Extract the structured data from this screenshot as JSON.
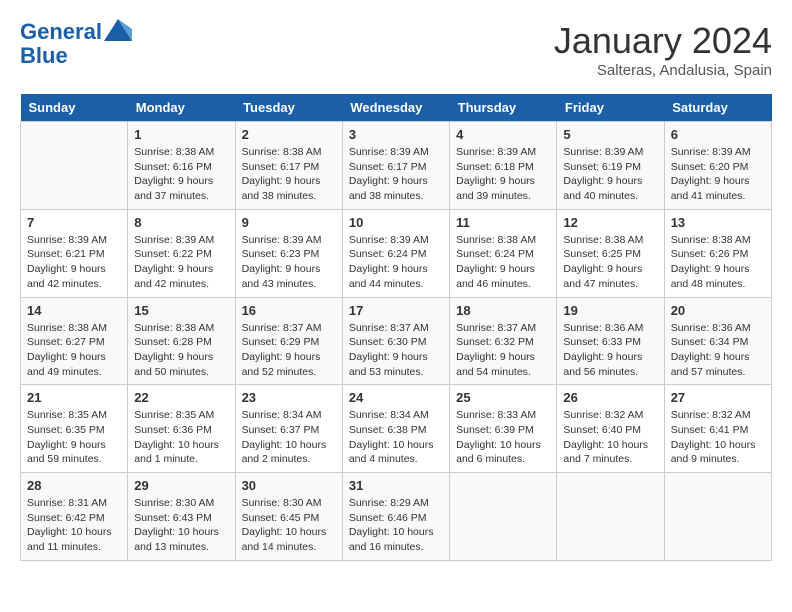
{
  "logo": {
    "line1": "General",
    "line2": "Blue"
  },
  "header": {
    "month": "January 2024",
    "location": "Salteras, Andalusia, Spain"
  },
  "weekdays": [
    "Sunday",
    "Monday",
    "Tuesday",
    "Wednesday",
    "Thursday",
    "Friday",
    "Saturday"
  ],
  "weeks": [
    [
      {
        "day": "",
        "info": ""
      },
      {
        "day": "1",
        "info": "Sunrise: 8:38 AM\nSunset: 6:16 PM\nDaylight: 9 hours\nand 37 minutes."
      },
      {
        "day": "2",
        "info": "Sunrise: 8:38 AM\nSunset: 6:17 PM\nDaylight: 9 hours\nand 38 minutes."
      },
      {
        "day": "3",
        "info": "Sunrise: 8:39 AM\nSunset: 6:17 PM\nDaylight: 9 hours\nand 38 minutes."
      },
      {
        "day": "4",
        "info": "Sunrise: 8:39 AM\nSunset: 6:18 PM\nDaylight: 9 hours\nand 39 minutes."
      },
      {
        "day": "5",
        "info": "Sunrise: 8:39 AM\nSunset: 6:19 PM\nDaylight: 9 hours\nand 40 minutes."
      },
      {
        "day": "6",
        "info": "Sunrise: 8:39 AM\nSunset: 6:20 PM\nDaylight: 9 hours\nand 41 minutes."
      }
    ],
    [
      {
        "day": "7",
        "info": "Sunrise: 8:39 AM\nSunset: 6:21 PM\nDaylight: 9 hours\nand 42 minutes."
      },
      {
        "day": "8",
        "info": "Sunrise: 8:39 AM\nSunset: 6:22 PM\nDaylight: 9 hours\nand 42 minutes."
      },
      {
        "day": "9",
        "info": "Sunrise: 8:39 AM\nSunset: 6:23 PM\nDaylight: 9 hours\nand 43 minutes."
      },
      {
        "day": "10",
        "info": "Sunrise: 8:39 AM\nSunset: 6:24 PM\nDaylight: 9 hours\nand 44 minutes."
      },
      {
        "day": "11",
        "info": "Sunrise: 8:38 AM\nSunset: 6:24 PM\nDaylight: 9 hours\nand 46 minutes."
      },
      {
        "day": "12",
        "info": "Sunrise: 8:38 AM\nSunset: 6:25 PM\nDaylight: 9 hours\nand 47 minutes."
      },
      {
        "day": "13",
        "info": "Sunrise: 8:38 AM\nSunset: 6:26 PM\nDaylight: 9 hours\nand 48 minutes."
      }
    ],
    [
      {
        "day": "14",
        "info": "Sunrise: 8:38 AM\nSunset: 6:27 PM\nDaylight: 9 hours\nand 49 minutes."
      },
      {
        "day": "15",
        "info": "Sunrise: 8:38 AM\nSunset: 6:28 PM\nDaylight: 9 hours\nand 50 minutes."
      },
      {
        "day": "16",
        "info": "Sunrise: 8:37 AM\nSunset: 6:29 PM\nDaylight: 9 hours\nand 52 minutes."
      },
      {
        "day": "17",
        "info": "Sunrise: 8:37 AM\nSunset: 6:30 PM\nDaylight: 9 hours\nand 53 minutes."
      },
      {
        "day": "18",
        "info": "Sunrise: 8:37 AM\nSunset: 6:32 PM\nDaylight: 9 hours\nand 54 minutes."
      },
      {
        "day": "19",
        "info": "Sunrise: 8:36 AM\nSunset: 6:33 PM\nDaylight: 9 hours\nand 56 minutes."
      },
      {
        "day": "20",
        "info": "Sunrise: 8:36 AM\nSunset: 6:34 PM\nDaylight: 9 hours\nand 57 minutes."
      }
    ],
    [
      {
        "day": "21",
        "info": "Sunrise: 8:35 AM\nSunset: 6:35 PM\nDaylight: 9 hours\nand 59 minutes."
      },
      {
        "day": "22",
        "info": "Sunrise: 8:35 AM\nSunset: 6:36 PM\nDaylight: 10 hours\nand 1 minute."
      },
      {
        "day": "23",
        "info": "Sunrise: 8:34 AM\nSunset: 6:37 PM\nDaylight: 10 hours\nand 2 minutes."
      },
      {
        "day": "24",
        "info": "Sunrise: 8:34 AM\nSunset: 6:38 PM\nDaylight: 10 hours\nand 4 minutes."
      },
      {
        "day": "25",
        "info": "Sunrise: 8:33 AM\nSunset: 6:39 PM\nDaylight: 10 hours\nand 6 minutes."
      },
      {
        "day": "26",
        "info": "Sunrise: 8:32 AM\nSunset: 6:40 PM\nDaylight: 10 hours\nand 7 minutes."
      },
      {
        "day": "27",
        "info": "Sunrise: 8:32 AM\nSunset: 6:41 PM\nDaylight: 10 hours\nand 9 minutes."
      }
    ],
    [
      {
        "day": "28",
        "info": "Sunrise: 8:31 AM\nSunset: 6:42 PM\nDaylight: 10 hours\nand 11 minutes."
      },
      {
        "day": "29",
        "info": "Sunrise: 8:30 AM\nSunset: 6:43 PM\nDaylight: 10 hours\nand 13 minutes."
      },
      {
        "day": "30",
        "info": "Sunrise: 8:30 AM\nSunset: 6:45 PM\nDaylight: 10 hours\nand 14 minutes."
      },
      {
        "day": "31",
        "info": "Sunrise: 8:29 AM\nSunset: 6:46 PM\nDaylight: 10 hours\nand 16 minutes."
      },
      {
        "day": "",
        "info": ""
      },
      {
        "day": "",
        "info": ""
      },
      {
        "day": "",
        "info": ""
      }
    ]
  ]
}
